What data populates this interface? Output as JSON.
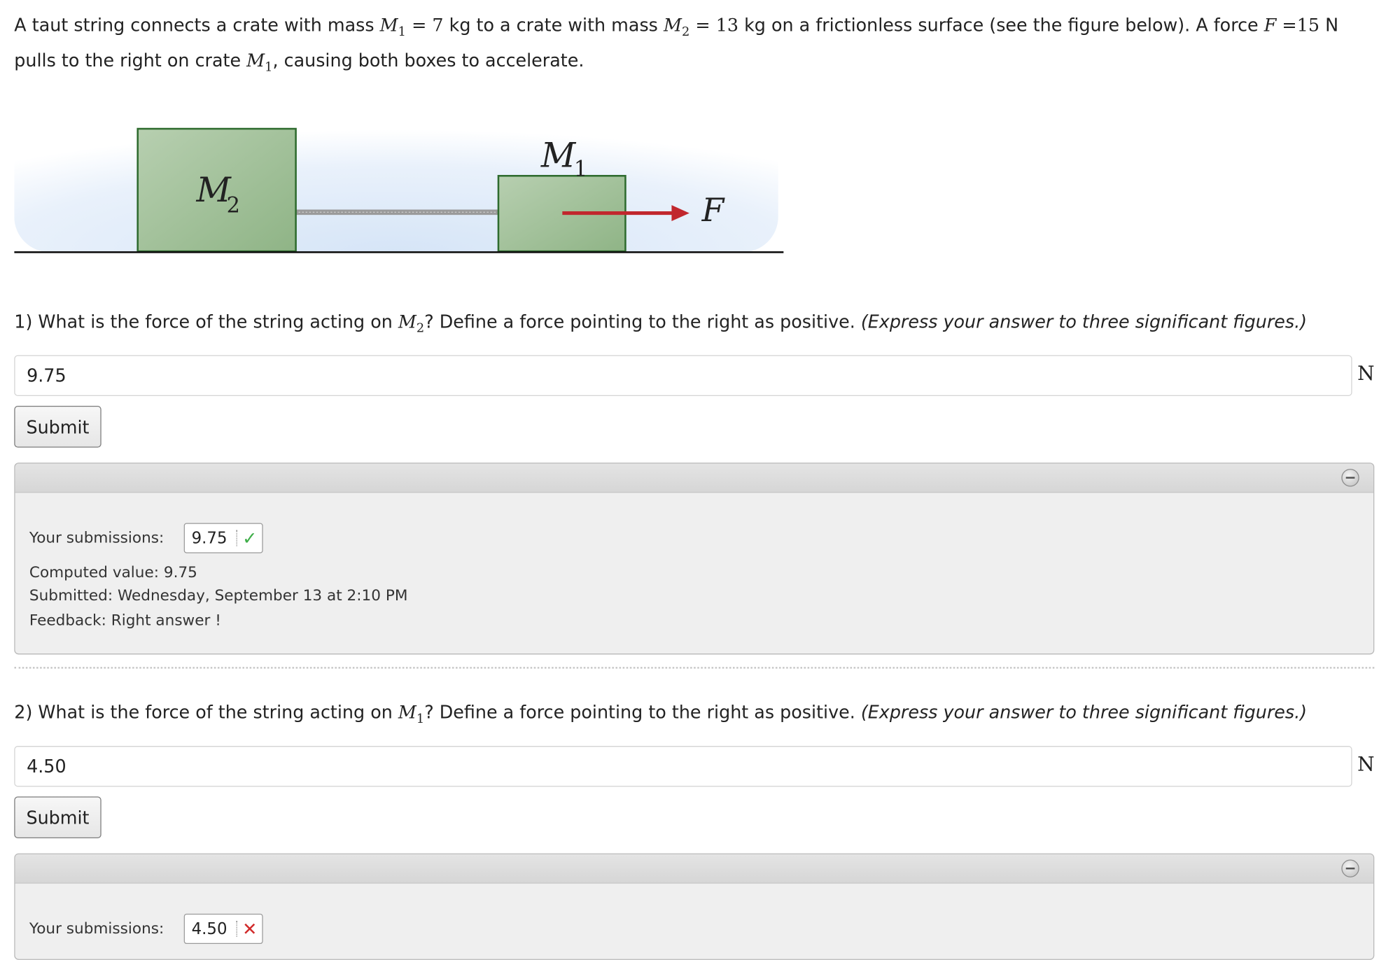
{
  "problem": {
    "t1": "A taut string connects a crate with mass ",
    "m1_sym": "M",
    "m1_sub": "1",
    "m1_eq": " = 7",
    "t2": " kg to a crate with mass ",
    "m2_sym": "M",
    "m2_sub": "2",
    "m2_eq": " = 13",
    "t3": " kg on a frictionless surface (see the figure below). A force ",
    "f_sym": "F",
    "f_eq": " =15",
    "t4": " N pulls to the right on crate ",
    "m1b_sym": "M",
    "m1b_sub": "1",
    "t5": ", causing both boxes to accelerate."
  },
  "figure": {
    "m1_label": "M",
    "m1_sub": "1",
    "m2_label": "M",
    "m2_sub": "2",
    "f_label": "F",
    "crate_color": "#9fc097",
    "arrow_color": "#c1272d"
  },
  "questions": [
    {
      "number": "1)",
      "text_a": " What is the force of the string acting on ",
      "sym": "M",
      "sub": "2",
      "text_b": "? Define a force pointing to the right as positive. ",
      "hint": "(Express your answer to three significant figures.)",
      "answer": "9.75",
      "unit": "N",
      "submit_label": "Submit",
      "submissions_label": "Your submissions:",
      "submission_value": "9.75",
      "submission_status": "correct",
      "computed": "Computed value: 9.75",
      "submitted": "Submitted: Wednesday, September 13 at 2:10 PM",
      "feedback": "Feedback: Right answer !"
    },
    {
      "number": "2)",
      "text_a": " What is the force of the string acting on ",
      "sym": "M",
      "sub": "1",
      "text_b": "? Define a force pointing to the right as positive. ",
      "hint": "(Express your answer to three significant figures.)",
      "answer": "4.50",
      "unit": "N",
      "submit_label": "Submit",
      "submissions_label": "Your submissions:",
      "submission_value": "4.50",
      "submission_status": "incorrect"
    }
  ],
  "icons": {
    "correct": "check-icon",
    "incorrect": "cross-icon",
    "collapse": "collapse-minus-icon"
  }
}
